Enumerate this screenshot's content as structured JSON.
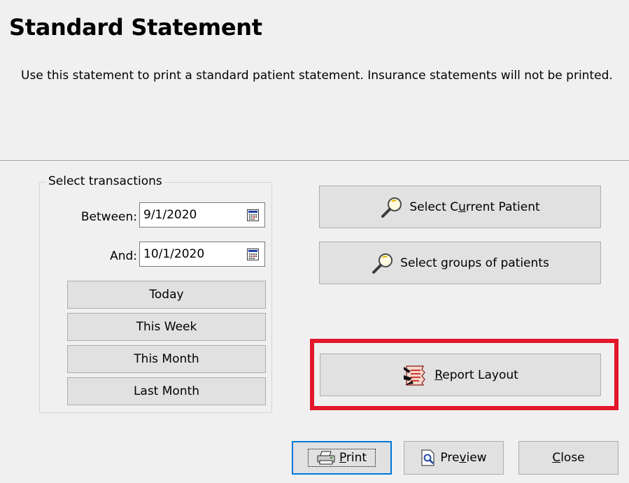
{
  "header": {
    "title": "Standard Statement",
    "description": "Use this statement to print a standard patient statement. Insurance statements will not be printed."
  },
  "transactions": {
    "group_label": "Select transactions",
    "between_label": "Between:",
    "between_value": "9/1/2020",
    "and_label": "And:",
    "and_value": "10/1/2020",
    "presets": [
      "Today",
      "This Week",
      "This Month",
      "Last Month"
    ]
  },
  "actions": {
    "select_current_patient": {
      "pre": "Select C",
      "ul": "u",
      "post": "rrent Patient"
    },
    "select_groups": {
      "pre": "Select ",
      "ul": "g",
      "post": "roups of patients"
    },
    "report_layout": {
      "pre": "",
      "ul": "R",
      "post": "eport Layout"
    }
  },
  "footer": {
    "print": {
      "pre": "",
      "ul": "P",
      "post": "rint"
    },
    "preview": {
      "pre": "Pre",
      "ul": "v",
      "post": "iew"
    },
    "close": {
      "pre": "",
      "ul": "C",
      "post": "lose"
    }
  },
  "colors": {
    "highlight": "#e3162a",
    "focus": "#0078d7",
    "button_face": "#e1e1e1",
    "background": "#f0f0f0"
  }
}
